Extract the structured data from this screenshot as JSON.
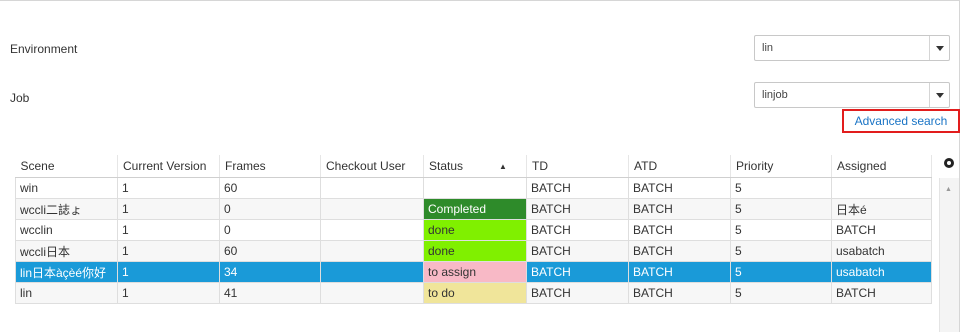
{
  "form": {
    "environment_label": "Environment",
    "environment_value": "lin",
    "job_label": "Job",
    "job_value": "linjob",
    "advanced_search": "Advanced search"
  },
  "colors": {
    "selected_row": "#1a9ad8",
    "status_completed": "#2e8b2a",
    "status_done": "#80f000",
    "status_to_assign": "#f8b9c6",
    "status_to_do": "#f0e59a",
    "advanced_border": "#e21d1d",
    "link": "#1a74c5"
  },
  "table": {
    "columns": [
      "Scene",
      "Current Version",
      "Frames",
      "Checkout User",
      "Status",
      "TD",
      "ATD",
      "Priority",
      "Assigned"
    ],
    "sort_column": "Status",
    "sort_direction": "ascending",
    "rows": [
      {
        "scene": "win",
        "version": "1",
        "frames": "60",
        "checkout": "",
        "status": "",
        "status_style": "none",
        "td": "BATCH",
        "atd": "BATCH",
        "priority": "5",
        "assigned": "",
        "selected": false
      },
      {
        "scene": "wccli二誌ょ",
        "version": "1",
        "frames": "0",
        "checkout": "",
        "status": "Completed",
        "status_style": "completed",
        "td": "BATCH",
        "atd": "BATCH",
        "priority": "5",
        "assigned": "日本é",
        "selected": false
      },
      {
        "scene": "wcclin",
        "version": "1",
        "frames": "0",
        "checkout": "",
        "status": "done",
        "status_style": "done",
        "td": "BATCH",
        "atd": "BATCH",
        "priority": "5",
        "assigned": "BATCH",
        "selected": false
      },
      {
        "scene": "wccli日本",
        "version": "1",
        "frames": "60",
        "checkout": "",
        "status": "done",
        "status_style": "done",
        "td": "BATCH",
        "atd": "BATCH",
        "priority": "5",
        "assigned": "usabatch",
        "selected": false
      },
      {
        "scene": "lin日本àçèé你好",
        "version": "1",
        "frames": "34",
        "checkout": "",
        "status": "to assign",
        "status_style": "to_assign",
        "td": "BATCH",
        "atd": "BATCH",
        "priority": "5",
        "assigned": "usabatch",
        "selected": true
      },
      {
        "scene": "lin",
        "version": "1",
        "frames": "41",
        "checkout": "",
        "status": "to do",
        "status_style": "to_do",
        "td": "BATCH",
        "atd": "BATCH",
        "priority": "5",
        "assigned": "BATCH",
        "selected": false
      }
    ]
  },
  "icons": {
    "dropdown": "chevron-down-icon",
    "settings": "gear-icon",
    "sort": "sort-asc-icon"
  }
}
